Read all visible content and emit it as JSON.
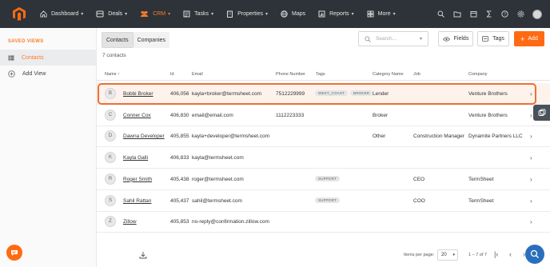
{
  "nav": {
    "items": [
      {
        "label": "Dashboard",
        "icon": "home-icon"
      },
      {
        "label": "Deals",
        "icon": "handshake-icon"
      },
      {
        "label": "CRM",
        "icon": "people-icon",
        "active": true
      },
      {
        "label": "Tasks",
        "icon": "checklist-icon"
      },
      {
        "label": "Properties",
        "icon": "building-icon"
      },
      {
        "label": "Maps",
        "icon": "globe-icon"
      },
      {
        "label": "Reports",
        "icon": "bar-chart-icon"
      },
      {
        "label": "More",
        "icon": "grid-icon"
      }
    ],
    "right_icons": [
      "search-icon",
      "folder-icon",
      "calendar-icon",
      "sigma-icon",
      "help-icon",
      "settings-icon",
      "user-avatar"
    ]
  },
  "sidebar": {
    "title": "SAVED VIEWS",
    "items": [
      {
        "label": "Contacts",
        "icon": "table-icon",
        "active": true
      },
      {
        "label": "Add View",
        "icon": "plus-circle-icon"
      }
    ]
  },
  "tabs": [
    "Contacts",
    "Companies"
  ],
  "count_text": "7 contacts",
  "search": {
    "placeholder": "Search..."
  },
  "buttons": {
    "fields": "Fields",
    "tags": "Tags",
    "add": "Add"
  },
  "table": {
    "columns": [
      "Name ↑",
      "Id",
      "Email",
      "Phone Number",
      "Tags",
      "Category Name",
      "Job",
      "Company"
    ],
    "rows": [
      {
        "initial": "B",
        "name": "Bobbi Broker",
        "id": "406,056",
        "email": "kayla+broker@termsheet.com",
        "phone": "7512229999",
        "tags": [
          "WEST_COAST",
          "BROKER"
        ],
        "category": "Lender",
        "job": "",
        "company": "Venture Brothers"
      },
      {
        "initial": "C",
        "name": "Conner Cox",
        "id": "406,830",
        "email": "email@email.com",
        "phone": "1112223333",
        "tags": [],
        "category": "Broker",
        "job": "",
        "company": "Venture Brothers"
      },
      {
        "initial": "D",
        "name": "Dawna Developer",
        "id": "405,855",
        "email": "kayla+developer@termsheet.com",
        "phone": "",
        "tags": [],
        "category": "Other",
        "job": "Construction Manager",
        "company": "Dynamite Partners LLC"
      },
      {
        "initial": "K",
        "name": "Kayla Galli",
        "id": "406,833",
        "email": "kayla@termsheet.com",
        "phone": "",
        "tags": [],
        "category": "",
        "job": "",
        "company": ""
      },
      {
        "initial": "R",
        "name": "Roger Smith",
        "id": "405,438",
        "email": "roger@termsheet.com",
        "phone": "",
        "tags": [
          "SUPPORT"
        ],
        "category": "",
        "job": "CEO",
        "company": "TermSheet"
      },
      {
        "initial": "S",
        "name": "Sahil Rattan",
        "id": "405,437",
        "email": "sahil@termsheet.com",
        "phone": "",
        "tags": [
          "SUPPORT"
        ],
        "category": "",
        "job": "COO",
        "company": "TermSheet"
      },
      {
        "initial": "Z",
        "name": "Zillow",
        "id": "405,853",
        "email": "no-reply@confirmation.zillow.com",
        "phone": "",
        "tags": [],
        "category": "",
        "job": "",
        "company": ""
      }
    ]
  },
  "footer": {
    "items_per_page_label": "Items per page:",
    "items_per_page": "20",
    "range": "1 – 7 of 7"
  },
  "colors": {
    "accent": "#ff6a13",
    "nav_bg": "#2d3338",
    "highlight": "#ed6f35"
  }
}
